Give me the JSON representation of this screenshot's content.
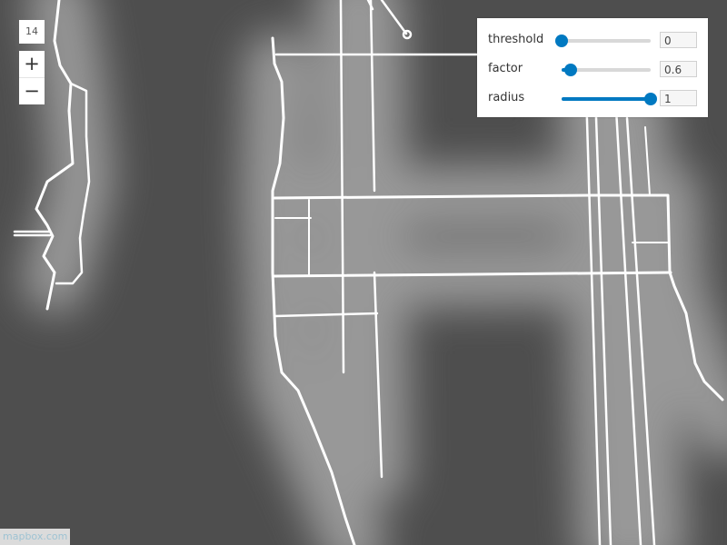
{
  "map": {
    "zoom_level": "14",
    "zoom_in_label": "+",
    "zoom_out_label": "−",
    "background_color": "#4e4e4e",
    "road_color": "#ffffff",
    "attribution": "mapbox.com"
  },
  "controls": {
    "accent_color": "#0079c1",
    "sliders": [
      {
        "name": "threshold",
        "label": "threshold",
        "value": "0",
        "fraction": 0.0
      },
      {
        "name": "factor",
        "label": "factor",
        "value": "0.6",
        "fraction": 0.1
      },
      {
        "name": "radius",
        "label": "radius",
        "value": "1",
        "fraction": 1.0
      }
    ]
  }
}
